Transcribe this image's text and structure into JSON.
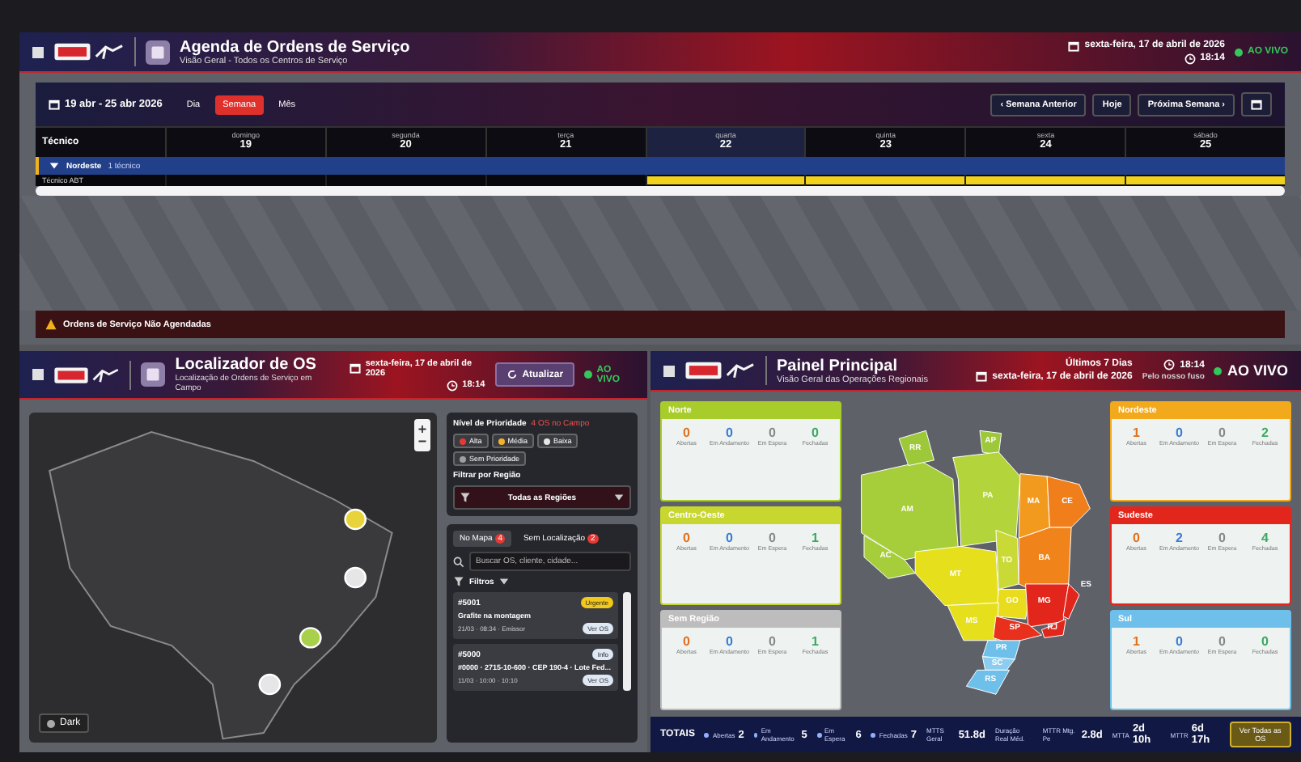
{
  "agenda": {
    "title": "Agenda de Ordens de Serviço",
    "subtitle": "Visão Geral - Todos os Centros de Serviço",
    "date": "sexta-feira, 17 de abril de 2026",
    "time": "18:14",
    "live": "AO VIVO",
    "range": "19 abr - 25 abr 2026",
    "views": [
      {
        "label": "Dia",
        "selected": false
      },
      {
        "label": "Semana",
        "selected": true
      },
      {
        "label": "Mês",
        "selected": false
      }
    ],
    "nav": [
      "‹ Semana Anterior",
      "Hoje",
      "Próxima Semana ›"
    ],
    "technician_header": "Técnico",
    "days": [
      {
        "weekday": "domingo",
        "day": "19",
        "today": false
      },
      {
        "weekday": "segunda",
        "day": "20",
        "today": false
      },
      {
        "weekday": "terça",
        "day": "21",
        "today": false
      },
      {
        "weekday": "quarta",
        "day": "22",
        "today": true
      },
      {
        "weekday": "quinta",
        "day": "23",
        "today": false
      },
      {
        "weekday": "sexta",
        "day": "24",
        "today": false
      },
      {
        "weekday": "sábado",
        "day": "25",
        "today": false
      }
    ],
    "group": {
      "label": "Nordeste",
      "count": "1 técnico",
      "expanded": true
    },
    "technicians": [
      {
        "name": "Técnico ABT",
        "booked": [
          false,
          false,
          false,
          true,
          true,
          true,
          true
        ]
      }
    ],
    "unscheduled": "Ordens de Serviço Não Agendadas"
  },
  "locator": {
    "title": "Localizador de OS",
    "subtitle": "Localização de Ordens de Serviço em Campo",
    "date": "sexta-feira, 17 de abril de 2026",
    "time": "18:14",
    "refresh": "Atualizar",
    "live": "AO VIVO",
    "markers": [
      {
        "color": "#e8d43a"
      },
      {
        "color": "#e6e6e6"
      },
      {
        "color": "#a8d04a"
      },
      {
        "color": "#e6e6e6"
      }
    ],
    "map_layer": "Dark",
    "priority_label": "Nível de Prioridade",
    "priority_count": "4 OS no Campo",
    "priorities": [
      {
        "label": "Alta",
        "color": "#e53935"
      },
      {
        "label": "Média",
        "color": "#f0b429"
      },
      {
        "label": "Baixa",
        "color": "#e6e6e6"
      },
      {
        "label": "Sem Prioridade",
        "color": "#9e9e9e"
      }
    ],
    "region_label": "Filtrar por Região",
    "region_value": "Todas as Regiões",
    "tabs": [
      {
        "label": "No Mapa",
        "count": "4",
        "selected": true
      },
      {
        "label": "Sem Localização",
        "count": "2",
        "selected": false
      }
    ],
    "search_placeholder": "Buscar OS, cliente, cidade...",
    "filters": "Filtros",
    "orders": [
      {
        "number": "#5001",
        "title": "Grafite na montagem",
        "meta": "21/03 · 08:34 · Emissor",
        "status": "Urgente",
        "kind": "urgent",
        "action": "Ver OS"
      },
      {
        "number": "#5000",
        "title": "#0000 · 2715-10-600 · CEP 190-4 · Lote Fed...",
        "meta": "11/03 · 10:00 · 10:10",
        "status": "Info",
        "kind": "info",
        "action": "Ver OS"
      }
    ]
  },
  "panel": {
    "title": "Painel Principal",
    "subtitle": "Visão Geral das Operações Regionais",
    "period": "Últimos 7 Dias",
    "date": "sexta-feira, 17 de abril de 2026",
    "time": "18:14",
    "time_note": "Pelo nosso fuso",
    "live": "AO VIVO",
    "regions_left": [
      {
        "name": "Norte",
        "color": "#a8cc2a",
        "stats": [
          {
            "value": "0",
            "label": "Abertas"
          },
          {
            "value": "0",
            "label": "Em Andamento"
          },
          {
            "value": "0",
            "label": "Em Espera"
          },
          {
            "value": "0",
            "label": "Fechadas"
          }
        ]
      },
      {
        "name": "Centro-Oeste",
        "color": "#c8d630",
        "stats": [
          {
            "value": "0",
            "label": "Abertas"
          },
          {
            "value": "0",
            "label": "Em Andamento"
          },
          {
            "value": "0",
            "label": "Em Espera"
          },
          {
            "value": "1",
            "label": "Fechadas"
          }
        ]
      },
      {
        "name": "Sem Região",
        "color": "#bdbdbd",
        "stats": [
          {
            "value": "0",
            "label": "Abertas"
          },
          {
            "value": "0",
            "label": "Em Andamento"
          },
          {
            "value": "0",
            "label": "Em Espera"
          },
          {
            "value": "1",
            "label": "Fechadas"
          }
        ]
      }
    ],
    "regions_right": [
      {
        "name": "Nordeste",
        "color": "#f2a91c",
        "stats": [
          {
            "value": "1",
            "label": "Abertas"
          },
          {
            "value": "0",
            "label": "Em Andamento"
          },
          {
            "value": "0",
            "label": "Em Espera"
          },
          {
            "value": "2",
            "label": "Fechadas"
          }
        ]
      },
      {
        "name": "Sudeste",
        "color": "#e3261c",
        "stats": [
          {
            "value": "0",
            "label": "Abertas"
          },
          {
            "value": "2",
            "label": "Em Andamento"
          },
          {
            "value": "0",
            "label": "Em Espera"
          },
          {
            "value": "4",
            "label": "Fechadas"
          }
        ]
      },
      {
        "name": "Sul",
        "color": "#6ec0ea",
        "stats": [
          {
            "value": "1",
            "label": "Abertas"
          },
          {
            "value": "0",
            "label": "Em Andamento"
          },
          {
            "value": "0",
            "label": "Em Espera"
          },
          {
            "value": "0",
            "label": "Fechadas"
          }
        ]
      }
    ],
    "states": [
      {
        "label": "AM",
        "color": "#a6cd3a"
      },
      {
        "label": "RR",
        "color": "#9cc83a"
      },
      {
        "label": "AP",
        "color": "#9cc83a"
      },
      {
        "label": "PA",
        "color": "#b3d43a"
      },
      {
        "label": "AC",
        "color": "#a6cd3a"
      },
      {
        "label": "MT",
        "color": "#e6df1c"
      },
      {
        "label": "TO",
        "color": "#c9da36"
      },
      {
        "label": "MA",
        "color": "#f29a1e"
      },
      {
        "label": "CE",
        "color": "#f07e1a"
      },
      {
        "label": "BA",
        "color": "#f0841a"
      },
      {
        "label": "GO",
        "color": "#e8dc1c"
      },
      {
        "label": "MS",
        "color": "#e6df1c"
      },
      {
        "label": "MG",
        "color": "#e3261c"
      },
      {
        "label": "ES",
        "color": "#e3261c"
      },
      {
        "label": "SP",
        "color": "#e8301c"
      },
      {
        "label": "RJ",
        "color": "#e3261c"
      },
      {
        "label": "PR",
        "color": "#6ec0ea"
      },
      {
        "label": "SC",
        "color": "#8ccdef"
      },
      {
        "label": "RS",
        "color": "#6ec0ea"
      }
    ],
    "totals": {
      "label": "TOTAIS",
      "counts": [
        {
          "label": "Abertas",
          "value": "2"
        },
        {
          "label": "Em Andamento",
          "value": "5"
        },
        {
          "label": "Em Espera",
          "value": "6"
        },
        {
          "label": "Fechadas",
          "value": "7"
        }
      ],
      "metrics": [
        {
          "label": "MTTS Geral",
          "value": "51.8d"
        },
        {
          "label": "Duração Real Méd."
        },
        {
          "label": "MTTR Mtg. Pe",
          "value": "2.8d"
        },
        {
          "label": "MTTA",
          "value": "2d 10h"
        },
        {
          "label": "MTTR",
          "value": "6d 17h"
        }
      ],
      "action": "Ver Todas as OS"
    }
  }
}
